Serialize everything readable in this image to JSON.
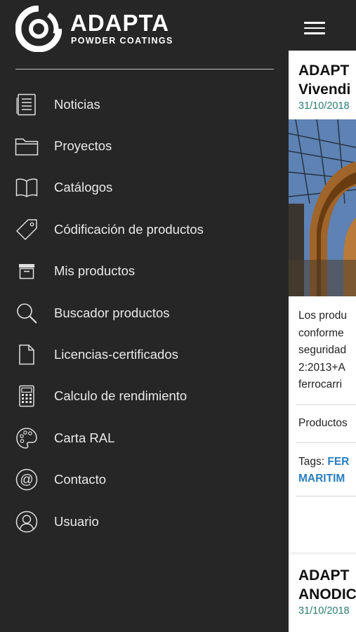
{
  "brand": {
    "name": "ADAPTA",
    "tagline": "POWDER COATINGS"
  },
  "menu": {
    "items": [
      {
        "label": "Noticias",
        "icon": "news-icon"
      },
      {
        "label": "Proyectos",
        "icon": "folder-icon"
      },
      {
        "label": "Catálogos",
        "icon": "book-icon"
      },
      {
        "label": "Códificación de productos",
        "icon": "tag-icon"
      },
      {
        "label": "Mis productos",
        "icon": "archive-box-icon"
      },
      {
        "label": "Buscador productos",
        "icon": "search-icon"
      },
      {
        "label": "Licencias-certificados",
        "icon": "document-icon"
      },
      {
        "label": "Calculo de rendimiento",
        "icon": "calculator-icon"
      },
      {
        "label": "Carta RAL",
        "icon": "palette-icon"
      },
      {
        "label": "Contacto",
        "icon": "at-sign-icon"
      },
      {
        "label": "Usuario",
        "icon": "user-icon"
      }
    ]
  },
  "feed": {
    "post1": {
      "title_line1": "ADAPT",
      "title_line2": "Vivendi",
      "date": "31/10/2018",
      "body_lines": [
        "Los produ",
        "conforme",
        "seguridad",
        "2:2013+A",
        "ferrocarri"
      ],
      "category": "Productos",
      "tags_label": "Tags:",
      "tag1": "FER",
      "tag2": "MARITIM"
    },
    "post2": {
      "title_line1": "ADAPT",
      "title_line2": "ANODIC",
      "date": "31/10/2018"
    }
  },
  "colors": {
    "drawer_bg": "#262626",
    "accent_date": "#2a7d6f",
    "tag_link": "#2a7dbf"
  }
}
